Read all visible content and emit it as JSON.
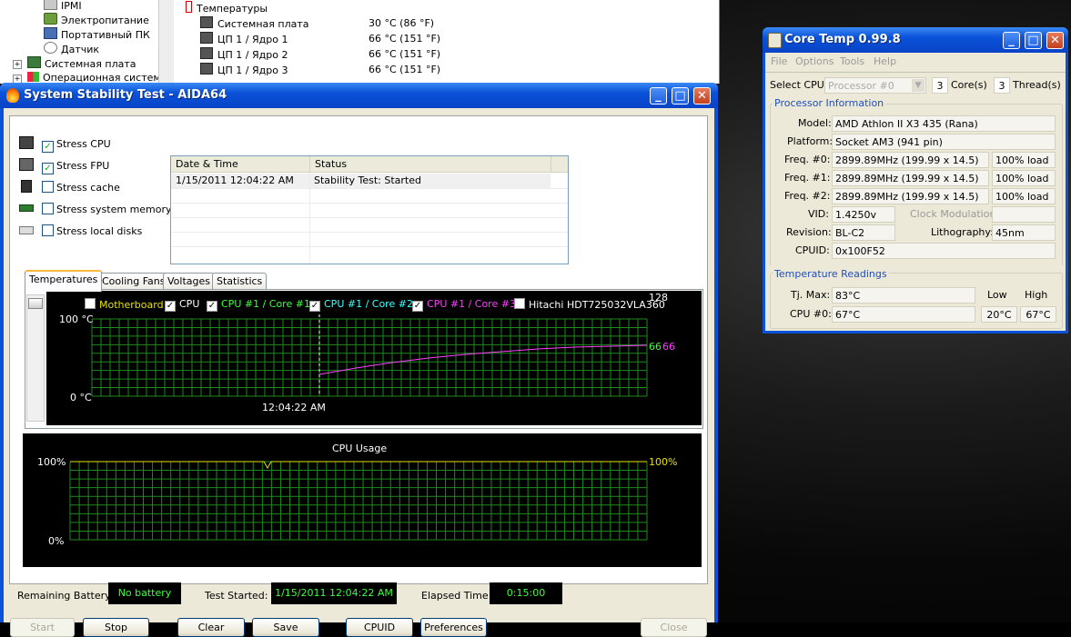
{
  "background_tree": {
    "items": [
      "IPMI",
      "Электропитание",
      "Портативный ПК",
      "Датчик",
      "Системная плата",
      "Операционная система"
    ]
  },
  "sensors": {
    "header": "Температуры",
    "rows": [
      {
        "name": "Системная плата",
        "value": "30 °C  (86 °F)"
      },
      {
        "name": "ЦП 1 / Ядро 1",
        "value": "66 °C  (151 °F)"
      },
      {
        "name": "ЦП 1 / Ядро 2",
        "value": "66 °C  (151 °F)"
      },
      {
        "name": "ЦП 1 / Ядро 3",
        "value": "66 °C  (151 °F)"
      }
    ]
  },
  "stability": {
    "title": "System Stability Test - AIDA64",
    "window_buttons": {
      "minimize": "_",
      "maximize": "□",
      "close": "✕"
    },
    "stress": [
      {
        "label": "Stress CPU",
        "checked": true
      },
      {
        "label": "Stress FPU",
        "checked": true
      },
      {
        "label": "Stress cache",
        "checked": false
      },
      {
        "label": "Stress system memory",
        "checked": false
      },
      {
        "label": "Stress local disks",
        "checked": false
      }
    ],
    "log": {
      "columns": [
        "Date & Time",
        "Status"
      ],
      "rows": [
        {
          "datetime": "1/15/2011 12:04:22 AM",
          "status": "Stability Test: Started"
        }
      ]
    },
    "tabs": [
      "Temperatures",
      "Cooling Fans",
      "Voltages",
      "Statistics"
    ],
    "active_tab": "Temperatures",
    "temp_graph": {
      "legend": [
        {
          "label": "Motherboard",
          "checked": false,
          "color": "#e8e000"
        },
        {
          "label": "CPU",
          "checked": true,
          "color": "#ffffff"
        },
        {
          "label": "CPU #1 / Core #1",
          "checked": true,
          "color": "#3cff3c"
        },
        {
          "label": "CPU #1 / Core #2",
          "checked": true,
          "color": "#3cffff"
        },
        {
          "label": "CPU #1 / Core #3",
          "checked": true,
          "color": "#ff3cff"
        },
        {
          "label": "Hitachi HDT725032VLA360",
          "checked": false,
          "color": "#ffffff"
        }
      ],
      "y_top_label": "100 °C",
      "y_bottom_label": "0 °C",
      "x_label": "12:04:22 AM",
      "scale_max": "128",
      "value_a": "66",
      "value_b": "66"
    },
    "cpu_graph": {
      "title": "CPU Usage",
      "y_top_label": "100%",
      "y_bottom_label": "0%",
      "value": "100%"
    },
    "status": {
      "battery_label": "Remaining Battery:",
      "battery_value": "No battery",
      "started_label": "Test Started:",
      "started_value": "1/15/2011 12:04:22 AM",
      "elapsed_label": "Elapsed Time:",
      "elapsed_value": "0:15:00"
    },
    "buttons": {
      "start": "Start",
      "stop": "Stop",
      "clear": "Clear",
      "save": "Save",
      "cpuid": "CPUID",
      "preferences": "Preferences",
      "close": "Close"
    }
  },
  "coretemp": {
    "title": "Core Temp 0.99.8",
    "menu": [
      "File",
      "Options",
      "Tools",
      "Help"
    ],
    "select_cpu_label": "Select CPU:",
    "select_cpu_value": "Processor #0",
    "cores_count": "3",
    "cores_label": "Core(s)",
    "threads_count": "3",
    "threads_label": "Thread(s)",
    "processor_info_title": "Processor Information",
    "model_label": "Model:",
    "model_value": "AMD Athlon II X3 435 (Rana)",
    "platform_label": "Platform:",
    "platform_value": "Socket AM3 (941 pin)",
    "freqs": [
      {
        "label": "Freq. #0:",
        "value": "2899.89MHz (199.99 x 14.5)",
        "load": "100% load"
      },
      {
        "label": "Freq. #1:",
        "value": "2899.89MHz (199.99 x 14.5)",
        "load": "100% load"
      },
      {
        "label": "Freq. #2:",
        "value": "2899.89MHz (199.99 x 14.5)",
        "load": "100% load"
      }
    ],
    "vid_label": "VID:",
    "vid_value": "1.4250v",
    "clock_mod_label": "Clock Modulation:",
    "clock_mod_value": "",
    "revision_label": "Revision:",
    "revision_value": "BL-C2",
    "litho_label": "Lithography:",
    "litho_value": "45nm",
    "cpuid_label": "CPUID:",
    "cpuid_value": "0x100F52",
    "temp_title": "Temperature Readings",
    "tjmax_label": "Tj. Max:",
    "tjmax_value": "83°C",
    "low_label": "Low",
    "high_label": "High",
    "cpu0_label": "CPU #0:",
    "cpu0_value": "67°C",
    "cpu0_low": "20°C",
    "cpu0_high": "67°C"
  }
}
